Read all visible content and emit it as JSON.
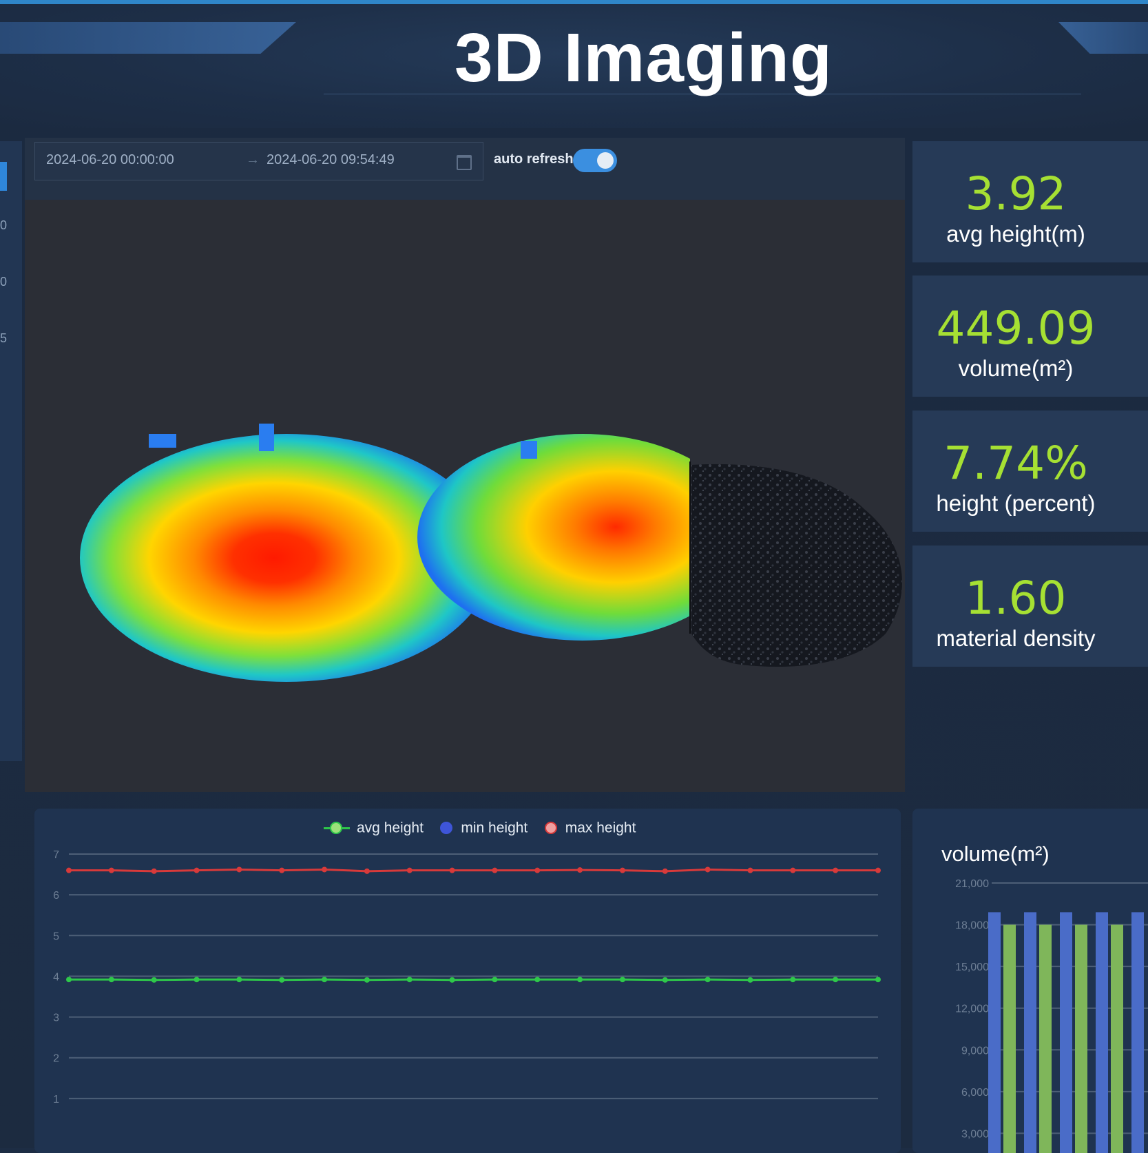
{
  "header": {
    "title": "3D Imaging"
  },
  "left_panel": {
    "axis_ticks": [
      "0",
      "0",
      "5"
    ]
  },
  "toolbar": {
    "start_date": "2024-06-20 00:00:00",
    "separator": "→",
    "end_date": "2024-06-20 09:54:49",
    "auto_refresh_label": "auto refresh",
    "auto_refresh_on": true
  },
  "stats": [
    {
      "value": "3.92",
      "label": "avg height(m)"
    },
    {
      "value": "449.09",
      "label": "volume(m²)"
    },
    {
      "value": "7.74%",
      "label": "height (percent)"
    },
    {
      "value": "1.60",
      "label": "material density"
    }
  ],
  "colors": {
    "accent": "#3b8fe0",
    "stat_value": "#a6e033",
    "avg_height": "#2ec84a",
    "min_height": "#3e55d8",
    "max_height": "#d83a3a",
    "bar_blue": "#4a6cc8",
    "bar_green": "#7fb65a"
  },
  "chart_data": [
    {
      "type": "line",
      "title": "",
      "legend": [
        "avg height",
        "min height",
        "max height"
      ],
      "legend_position": "top",
      "ylim": [
        0,
        7
      ],
      "ytick_labels": [
        "1",
        "2",
        "3",
        "4",
        "5",
        "6",
        "7"
      ],
      "grid": true,
      "series": [
        {
          "name": "avg height",
          "values": [
            3.92,
            3.92,
            3.91,
            3.92,
            3.92,
            3.91,
            3.92,
            3.91,
            3.92,
            3.91,
            3.92,
            3.92,
            3.92,
            3.92,
            3.91,
            3.92,
            3.91,
            3.92,
            3.92,
            3.92
          ]
        },
        {
          "name": "max height",
          "values": [
            6.6,
            6.6,
            6.58,
            6.6,
            6.62,
            6.6,
            6.62,
            6.58,
            6.6,
            6.6,
            6.6,
            6.6,
            6.61,
            6.6,
            6.58,
            6.62,
            6.6,
            6.6,
            6.6,
            6.6
          ]
        }
      ]
    },
    {
      "type": "bar",
      "title": "volume(m²)",
      "ylim": [
        0,
        21000
      ],
      "ytick_labels": [
        "3,000",
        "6,000",
        "9,000",
        "12,000",
        "15,000",
        "18,000",
        "21,000"
      ],
      "grid": true,
      "series": [
        {
          "values": [
            18900,
            18900,
            18900,
            18900,
            18900
          ]
        },
        {
          "values": [
            18000,
            18000,
            18000,
            18000
          ]
        }
      ]
    }
  ]
}
